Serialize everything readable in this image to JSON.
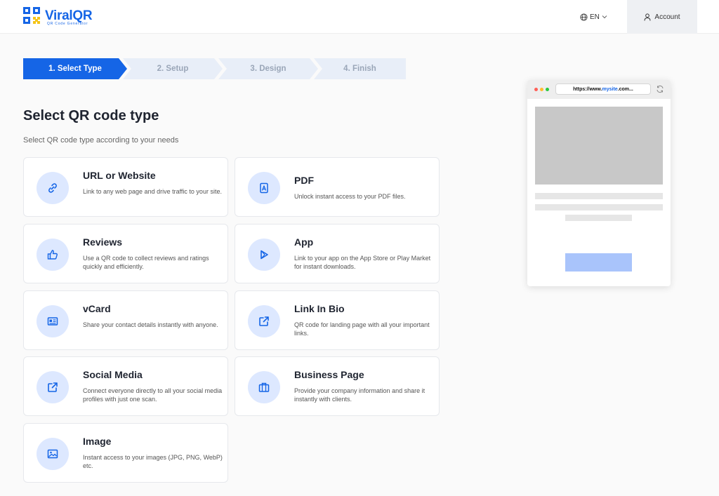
{
  "header": {
    "brand": "ViralQR",
    "brand_tagline": "QR Code Generator",
    "language": "EN",
    "account_label": "Account"
  },
  "stepper": {
    "steps": [
      {
        "label": "1. Select Type",
        "active": true
      },
      {
        "label": "2. Setup",
        "active": false
      },
      {
        "label": "3. Design",
        "active": false
      },
      {
        "label": "4. Finish",
        "active": false
      }
    ]
  },
  "page": {
    "title": "Select QR code type",
    "subtitle": "Select QR code type according to your needs"
  },
  "qr_types": [
    {
      "title": "URL or Website",
      "description": "Link to any web page and drive traffic to your site.",
      "icon": "link-icon"
    },
    {
      "title": "PDF",
      "description": "Unlock instant access to your PDF files.",
      "icon": "pdf-icon"
    },
    {
      "title": "Reviews",
      "description": "Use a QR code to collect reviews and ratings quickly and efficiently.",
      "icon": "thumbs-up-icon"
    },
    {
      "title": "App",
      "description": "Link to your app on the App Store or Play Market for instant downloads.",
      "icon": "play-store-icon"
    },
    {
      "title": "vCard",
      "description": "Share your contact details instantly with anyone.",
      "icon": "contact-card-icon"
    },
    {
      "title": "Link In Bio",
      "description": "QR code for landing page with all your important links.",
      "icon": "external-link-icon"
    },
    {
      "title": "Social Media",
      "description": "Connect everyone directly to all your social media profiles with just one scan.",
      "icon": "share-icon"
    },
    {
      "title": "Business Page",
      "description": "Provide your company information and share it instantly with clients.",
      "icon": "briefcase-icon"
    },
    {
      "title": "Image",
      "description": "Instant access to your images (JPG, PNG, WebP) etc.",
      "icon": "image-icon"
    }
  ],
  "preview": {
    "url_prefix": "https://www.",
    "url_highlight": "mysite",
    "url_suffix": ".com..."
  },
  "colors": {
    "accent": "#1565e6",
    "step_inactive": "#e8eef8",
    "icon_circle": "#dde8ff"
  }
}
